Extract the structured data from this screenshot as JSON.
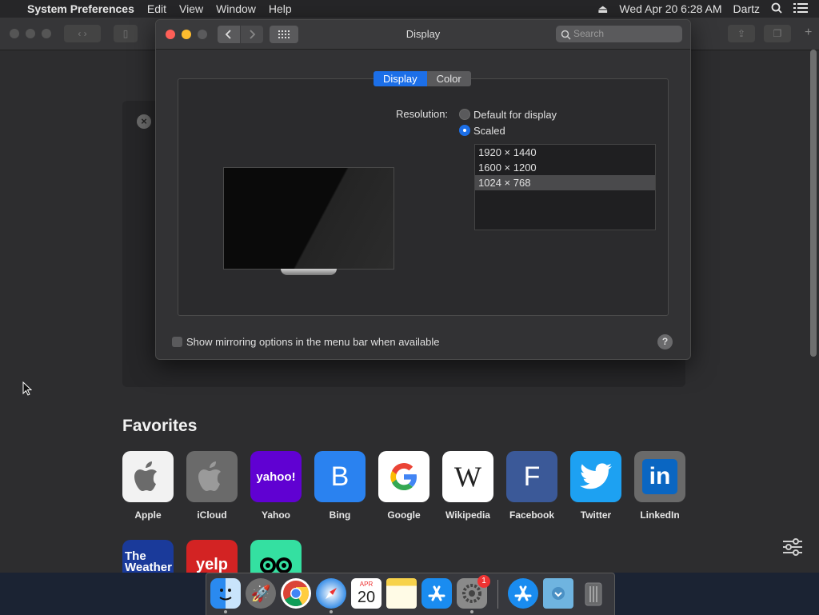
{
  "menubar": {
    "app_name": "System Preferences",
    "menus": [
      "Edit",
      "View",
      "Window",
      "Help"
    ],
    "datetime": "Wed Apr 20  6:28 AM",
    "user": "Dartz"
  },
  "window": {
    "title": "Display",
    "search_placeholder": "Search",
    "tabs": [
      {
        "label": "Display",
        "active": true
      },
      {
        "label": "Color",
        "active": false
      }
    ],
    "resolution_label": "Resolution:",
    "resolution_options": [
      {
        "label": "Default for display",
        "selected": false
      },
      {
        "label": "Scaled",
        "selected": true
      }
    ],
    "scaled_resolutions": [
      {
        "label": "1920 × 1440",
        "selected": false
      },
      {
        "label": "1600 × 1200",
        "selected": false
      },
      {
        "label": "1024 × 768",
        "selected": true
      }
    ],
    "mirror_checkbox_label": "Show mirroring options in the menu bar when available",
    "mirror_checked": false,
    "help_label": "?"
  },
  "safari": {
    "favorites_title": "Favorites",
    "favorites": [
      {
        "label": "Apple",
        "tile_text": "",
        "bg": "#f2f2f2",
        "fg": "#555"
      },
      {
        "label": "iCloud",
        "tile_text": "",
        "bg": "#6a6a6a",
        "fg": "#bbb"
      },
      {
        "label": "Yahoo",
        "tile_text": "yahoo!",
        "bg": "#6001d2",
        "fg": "#ffffff"
      },
      {
        "label": "Bing",
        "tile_text": "B",
        "bg": "#2a82f0",
        "fg": "#ffffff"
      },
      {
        "label": "Google",
        "tile_text": "G",
        "bg": "#ffffff",
        "fg": "#4285f4"
      },
      {
        "label": "Wikipedia",
        "tile_text": "W",
        "bg": "#ffffff",
        "fg": "#222"
      },
      {
        "label": "Facebook",
        "tile_text": "F",
        "bg": "#3b5998",
        "fg": "#ffffff"
      },
      {
        "label": "Twitter",
        "tile_text": "",
        "bg": "#1da1f2",
        "fg": "#ffffff"
      },
      {
        "label": "LinkedIn",
        "tile_text": "in",
        "bg": "#6a6a6a",
        "fg": "#ffffff"
      }
    ],
    "second_row": [
      {
        "tile_text": "The Weather",
        "bg": "#1a3a9a"
      },
      {
        "tile_text": "yelp",
        "bg": "#d32323"
      },
      {
        "tile_text": "",
        "bg": "#34e0a1"
      }
    ]
  },
  "dock": {
    "calendar_month": "APR",
    "calendar_day": "20",
    "badge_count": "1"
  }
}
